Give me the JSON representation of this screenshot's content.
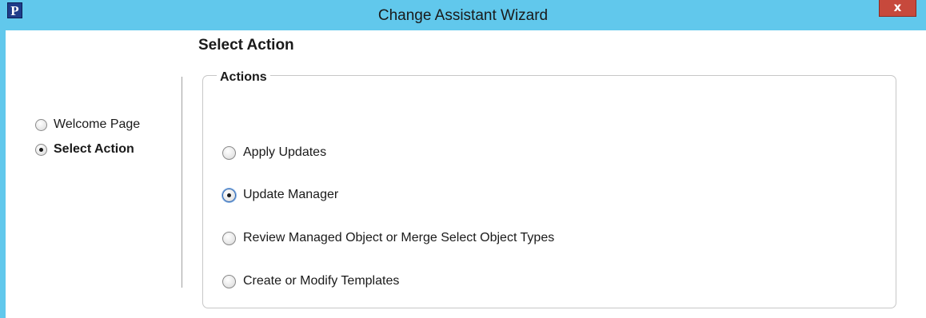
{
  "window": {
    "title": "Change Assistant Wizard",
    "app_icon_letter": "P",
    "close_label": "x"
  },
  "page": {
    "heading": "Select Action"
  },
  "steps": [
    {
      "label": "Welcome Page",
      "selected": false
    },
    {
      "label": "Select Action",
      "selected": true
    }
  ],
  "actions_group": {
    "title": "Actions",
    "options": [
      {
        "label": "Apply Updates",
        "selected": false
      },
      {
        "label": "Update Manager",
        "selected": true
      },
      {
        "label": "Review Managed Object or Merge Select Object Types",
        "selected": false
      },
      {
        "label": "Create or Modify Templates",
        "selected": false
      }
    ]
  },
  "colors": {
    "titlebar": "#61c8ec",
    "close_button": "#c7493c",
    "client_background": "#ffffff"
  }
}
